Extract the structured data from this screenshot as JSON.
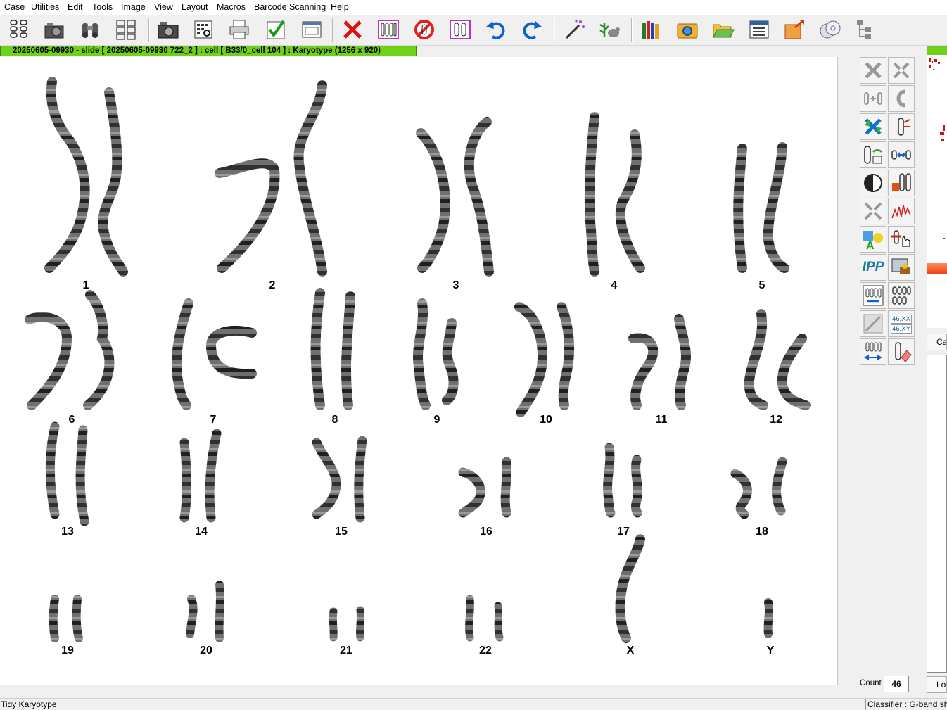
{
  "menu": [
    "Case",
    "Utilities",
    "Edit",
    "Tools",
    "Image",
    "View",
    "Layout",
    "Macros",
    "Barcode Scanning",
    "Help"
  ],
  "toolbar": {
    "icons": [
      "karyotype-grid-icon",
      "camera-icon",
      "binoculars-icon",
      "chromosome-layout-icon",
      "camera-capture-icon",
      "scan-slide-icon",
      "printer-icon",
      "checkmark-icon",
      "window-icon",
      "reject-x-icon",
      "karyogram-select-icon",
      "not-allowed-icon",
      "chromosome-pair-icon",
      "undo-icon",
      "redo-icon",
      "magic-wand-icon",
      "plant-animal-icon",
      "books-icon",
      "gear-folder-icon",
      "open-folder-icon",
      "list-window-icon",
      "export-box-icon",
      "cd-icon",
      "tree-icon"
    ]
  },
  "title_bar": "20250605-09930 - slide [ 20250605-09930 722_2 ] : cell [ B33/0_cell 104 ] : Karyotype  (1256 x 920)",
  "karyotype": {
    "labels": [
      "1",
      "2",
      "3",
      "4",
      "5",
      "6",
      "7",
      "8",
      "9",
      "10",
      "11",
      "12",
      "13",
      "14",
      "15",
      "16",
      "17",
      "18",
      "19",
      "20",
      "21",
      "22",
      "X",
      "Y"
    ]
  },
  "side_tools": [
    "delete-icon",
    "cut-chromosome-icon",
    "join-icon",
    "bend-icon",
    "swap-icon",
    "straighten-icon",
    "rotate-icon",
    "measure-icon",
    "contrast-icon",
    "pair-edit-icon",
    "split-icon",
    "profile-icon",
    "annotate-icon",
    "select-hand-icon",
    "ipp-icon",
    "display-icon",
    "karyogram-view-icon",
    "grid-icon",
    "enhance-icon",
    "sex-chromosome-icon",
    "layout-arrows-icon",
    "eraser-icon"
  ],
  "ipp_text": "IPP",
  "sex_text": [
    "46,XX",
    "46,XY"
  ],
  "right_panel": {
    "button1": "Ca",
    "button2": "Lo"
  },
  "count": {
    "label": "Count",
    "value": "46"
  },
  "status": {
    "left": "Tidy Karyotype",
    "right": "Classifier : G-band sho"
  }
}
